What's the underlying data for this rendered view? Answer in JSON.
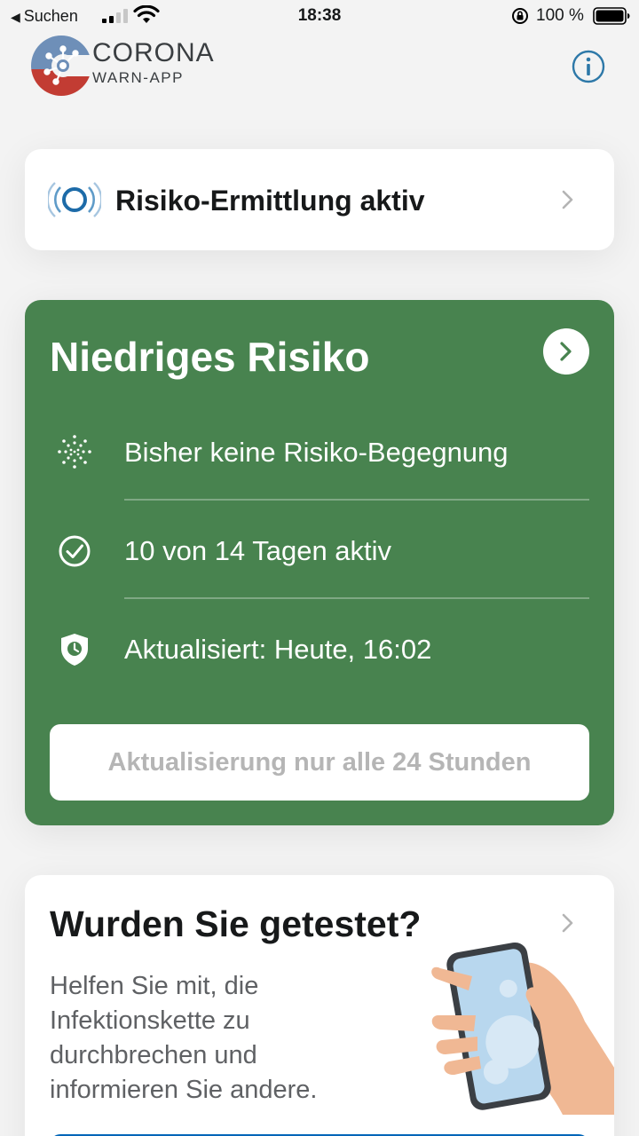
{
  "status_bar": {
    "back_label": "Suchen",
    "time": "18:38",
    "battery_percent": "100 %",
    "icons": [
      "back-triangle-icon",
      "cellular-signal-icon",
      "wifi-icon",
      "orientation-lock-icon",
      "battery-icon"
    ]
  },
  "header": {
    "app_name": "CORONA",
    "app_subtitle": "WARN-APP",
    "info_icon": "info-icon"
  },
  "tracing": {
    "label": "Risiko-Ermittlung aktiv",
    "icon": "tracing-waves-icon"
  },
  "risk_card": {
    "title": "Niedriges Risiko",
    "rows": [
      {
        "icon": "virus-dots-icon",
        "text": "Bisher keine Risiko-Begegnung"
      },
      {
        "icon": "check-circle-icon",
        "text": "10 von 14 Tagen aktiv"
      },
      {
        "icon": "shield-clock-icon",
        "text": "Aktualisiert: Heute, 16:02"
      }
    ],
    "button_label": "Aktualisierung nur alle 24 Stunden"
  },
  "test_card": {
    "title": "Wurden Sie getestet?",
    "body": "Helfen Sie mit, die Infektionskette zu durchbrechen und informieren Sie andere.",
    "illustration": "hand-holding-phone-illustration"
  },
  "colors": {
    "risk_green": "#48834f",
    "accent_blue": "#0065b8",
    "background": "#f3f3f3"
  }
}
